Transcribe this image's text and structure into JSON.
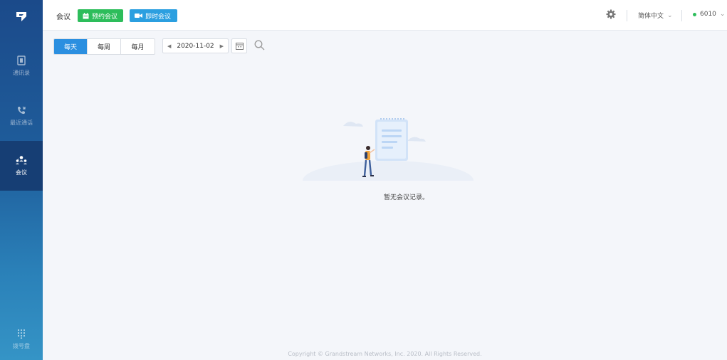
{
  "sidebar": {
    "items": [
      {
        "label": "通讯录",
        "icon": "contacts-icon"
      },
      {
        "label": "最近通话",
        "icon": "recent-calls-icon"
      },
      {
        "label": "会议",
        "icon": "meeting-icon"
      },
      {
        "label": "拨号盘",
        "icon": "dialpad-icon"
      }
    ]
  },
  "header": {
    "title": "会议",
    "schedule_label": "预约会议",
    "instant_label": "即时会议",
    "language": "简体中文",
    "account": "6010",
    "status_color": "#2dbd5b"
  },
  "toolbar": {
    "views": [
      "每天",
      "每周",
      "每月"
    ],
    "active_view": "每天",
    "date": "2020-11-02"
  },
  "empty": {
    "message": "暂无会议记录。"
  },
  "footer": {
    "copyright": "Copyright © Grandstream Networks, Inc. 2020. All Rights Reserved."
  }
}
